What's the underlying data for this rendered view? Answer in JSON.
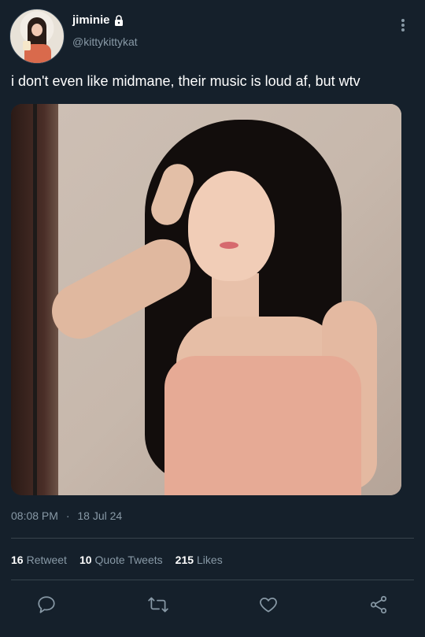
{
  "user": {
    "display_name": "jiminie",
    "handle": "@kittykittykat",
    "verified_lock_icon": "lock-icon"
  },
  "tweet": {
    "text": "i don't even like midmane, their music is loud af, but wtv",
    "time": "08:08 PM",
    "separator": "·",
    "date": "18 Jul 24"
  },
  "stats": {
    "retweets_count": "16",
    "retweets_label": "Retweet",
    "quotes_count": "10",
    "quotes_label": "Quote Tweets",
    "likes_count": "215",
    "likes_label": "Likes"
  },
  "icons": {
    "more": "more-vertical-icon",
    "reply": "reply-icon",
    "retweet": "retweet-icon",
    "like": "heart-icon",
    "share": "share-icon"
  },
  "colors": {
    "background": "#15202b",
    "secondary_text": "#8899a6",
    "divider": "#38444d"
  }
}
